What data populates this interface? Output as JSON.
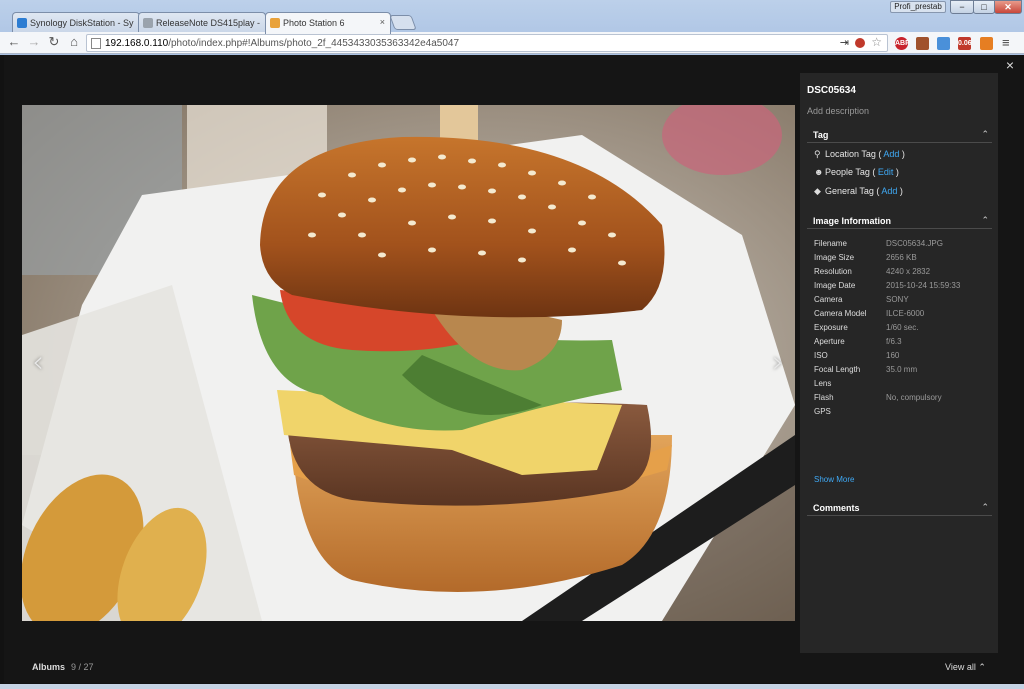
{
  "browser": {
    "tabs": [
      {
        "title": "Synology DiskStation - Sy",
        "favicon_color": "#2d7dd2",
        "favicon_text": "DSM"
      },
      {
        "title": "ReleaseNote DS415play -",
        "favicon_color": "#9aa3ad",
        "favicon_text": ""
      },
      {
        "title": "Photo Station 6",
        "favicon_color": "#e9a23b",
        "favicon_text": ""
      }
    ],
    "close_tab_glyph": "×",
    "profile_label": "Profi_prestab",
    "window_buttons": {
      "minimize": "−",
      "maximize": "□",
      "close": "✕"
    },
    "url_host": "192.168.0.110",
    "url_path": "/photo/index.php#!Albums/photo_2f_4453433035363342e4a5047",
    "extensions": [
      {
        "name": "abp-icon",
        "color": "#c8232c",
        "text": "ABP"
      },
      {
        "name": "instagram-icon",
        "color": "#a0522d",
        "text": ""
      },
      {
        "name": "camera-icon",
        "color": "#4a90d9",
        "text": ""
      },
      {
        "name": "badge-icon",
        "color": "#c0392b",
        "text": "0.06"
      },
      {
        "name": "mail-icon",
        "color": "#e67e22",
        "text": ""
      }
    ]
  },
  "viewer": {
    "close_glyph": "×",
    "prev_glyph": "‹",
    "next_glyph": "›",
    "bottom": {
      "albums_label": "Albums",
      "position": "9 / 27",
      "view_all_label": "View all",
      "view_all_glyph": "⌃"
    }
  },
  "sidebar": {
    "title": "DSC05634",
    "add_description": "Add description",
    "sections": {
      "tag": {
        "label": "Tag",
        "chev": "⌃"
      },
      "info": {
        "label": "Image Information",
        "chev": "⌃"
      },
      "comments": {
        "label": "Comments",
        "chev": "⌃"
      }
    },
    "tags": [
      {
        "icon": "location-pin-icon",
        "glyph": "⚲",
        "label": "Location Tag",
        "open": " ( ",
        "action": "Add",
        "close": " )"
      },
      {
        "icon": "person-icon",
        "glyph": "☻",
        "label": "People Tag",
        "open": " ( ",
        "action": "Edit",
        "close": " )"
      },
      {
        "icon": "tag-icon",
        "glyph": "◆",
        "label": "General Tag",
        "open": " ( ",
        "action": "Add",
        "close": " )"
      }
    ],
    "image_info": [
      {
        "key": "Filename",
        "value": "DSC05634.JPG"
      },
      {
        "key": "Image Size",
        "value": "2656 KB"
      },
      {
        "key": "Resolution",
        "value": "4240 x 2832"
      },
      {
        "key": "Image Date",
        "value": "2015-10-24 15:59:33"
      },
      {
        "key": "Camera",
        "value": "SONY"
      },
      {
        "key": "Camera Model",
        "value": "ILCE-6000"
      },
      {
        "key": "Exposure",
        "value": "1/60 sec."
      },
      {
        "key": "Aperture",
        "value": "f/6.3"
      },
      {
        "key": "ISO",
        "value": "160"
      },
      {
        "key": "Focal Length",
        "value": "35.0 mm"
      },
      {
        "key": "Lens",
        "value": ""
      },
      {
        "key": "Flash",
        "value": "No, compulsory"
      },
      {
        "key": "GPS",
        "value": ""
      }
    ],
    "show_more": "Show More"
  }
}
